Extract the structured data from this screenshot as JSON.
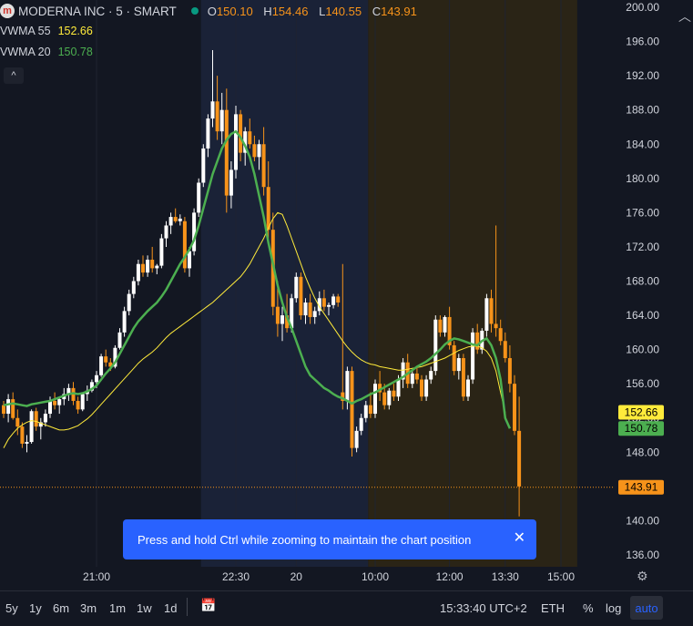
{
  "header": {
    "logo_letter": "m",
    "symbol": "MODERNA INC · 5 · SMART",
    "ohlc": [
      {
        "k": "O",
        "v": "150.10"
      },
      {
        "k": "H",
        "v": "154.46"
      },
      {
        "k": "L",
        "v": "140.55"
      },
      {
        "k": "C",
        "v": "143.91"
      }
    ],
    "vwma55_label": "VWMA 55",
    "vwma55_value": "152.66",
    "vwma20_label": "VWMA 20",
    "vwma20_value": "150.78",
    "collapse_icon": "^"
  },
  "toast": {
    "message": "Press and hold Ctrl while zooming to maintain the chart position",
    "close": "✕"
  },
  "bottom": {
    "ranges": [
      "5y",
      "1y",
      "6m",
      "3m",
      "1m",
      "1w",
      "1d"
    ],
    "time": "15:33:40 UTC+2",
    "session": "ETH",
    "percent": "%",
    "log": "log",
    "auto": "auto"
  },
  "colors": {
    "up": "#ffffff",
    "down": "#f7931a",
    "vwma20": "#4caf50",
    "vwma55": "#ffeb3b",
    "premarket_bg": "#1a2237",
    "postmarket_bg": "#2a2416",
    "price_badge": "#f7931a"
  },
  "chart_data": {
    "type": "candlestick",
    "yaxis": {
      "min": 136,
      "max": 200,
      "step": 4,
      "ticks": [
        "200.00",
        "196.00",
        "192.00",
        "188.00",
        "184.00",
        "180.00",
        "176.00",
        "172.00",
        "168.00",
        "164.00",
        "160.00",
        "156.00",
        "152.00",
        "148.00",
        "144.00",
        "140.00",
        "136.00"
      ]
    },
    "xaxis": {
      "ticks": [
        {
          "label": "21:00",
          "bar": 20
        },
        {
          "label": "22:30",
          "bar": 50
        },
        {
          "label": "20",
          "bar": 63
        },
        {
          "label": "10:00",
          "bar": 80
        },
        {
          "label": "12:00",
          "bar": 96
        },
        {
          "label": "13:30",
          "bar": 108
        },
        {
          "label": "15:00",
          "bar": 120
        }
      ]
    },
    "sessions": [
      {
        "kind": "premarket",
        "from": 43,
        "to": 79
      },
      {
        "kind": "postmarket",
        "from": 79,
        "to": 124
      }
    ],
    "last_price": 143.91,
    "price_labels": [
      {
        "text": "152.66",
        "value": 152.66,
        "color": "#ffeb3b",
        "text_color": "#000000"
      },
      {
        "text": "150.78",
        "value": 150.78,
        "color": "#4caf50",
        "text_color": "#000000"
      },
      {
        "text": "143.91",
        "value": 143.91,
        "color": "#f7931a",
        "text_color": "#000000"
      }
    ],
    "candles": [
      [
        153.5,
        154.0,
        152.0,
        152.5
      ],
      [
        152.5,
        154.8,
        151.5,
        154.2
      ],
      [
        154.2,
        155.0,
        151.8,
        152.0
      ],
      [
        152.0,
        153.0,
        150.0,
        151.0
      ],
      [
        151.0,
        151.5,
        148.5,
        149.0
      ],
      [
        149.0,
        150.0,
        148.0,
        149.2
      ],
      [
        149.2,
        153.0,
        149.0,
        152.8
      ],
      [
        152.8,
        153.2,
        150.5,
        151.0
      ],
      [
        151.0,
        152.0,
        149.5,
        151.5
      ],
      [
        151.5,
        153.0,
        151.0,
        152.5
      ],
      [
        152.5,
        154.5,
        152.0,
        154.0
      ],
      [
        154.0,
        155.0,
        153.0,
        153.5
      ],
      [
        153.5,
        154.5,
        152.5,
        154.2
      ],
      [
        154.2,
        155.5,
        153.5,
        154.8
      ],
      [
        154.8,
        156.0,
        154.0,
        155.5
      ],
      [
        155.5,
        156.2,
        153.5,
        154.0
      ],
      [
        154.0,
        154.5,
        152.5,
        153.0
      ],
      [
        153.0,
        155.0,
        152.8,
        154.8
      ],
      [
        154.8,
        155.8,
        154.0,
        155.2
      ],
      [
        155.2,
        156.5,
        155.0,
        156.2
      ],
      [
        156.2,
        157.5,
        155.5,
        157.0
      ],
      [
        157.0,
        159.5,
        156.8,
        159.2
      ],
      [
        159.2,
        160.0,
        158.0,
        158.5
      ],
      [
        158.5,
        159.0,
        157.5,
        158.0
      ],
      [
        158.0,
        160.5,
        157.8,
        160.2
      ],
      [
        160.2,
        162.5,
        160.0,
        162.0
      ],
      [
        162.0,
        165.0,
        161.5,
        164.5
      ],
      [
        164.5,
        167.0,
        164.0,
        166.5
      ],
      [
        166.5,
        168.5,
        166.0,
        168.0
      ],
      [
        168.0,
        170.5,
        167.5,
        170.0
      ],
      [
        170.0,
        171.0,
        168.5,
        169.0
      ],
      [
        169.0,
        171.0,
        168.5,
        170.5
      ],
      [
        170.5,
        172.0,
        169.0,
        169.5
      ],
      [
        169.5,
        170.0,
        168.8,
        169.8
      ],
      [
        169.8,
        173.5,
        169.5,
        173.0
      ],
      [
        173.0,
        175.0,
        172.0,
        174.5
      ],
      [
        174.5,
        176.0,
        173.5,
        175.5
      ],
      [
        175.5,
        176.5,
        174.8,
        175.0
      ],
      [
        175.0,
        175.8,
        174.5,
        175.3
      ],
      [
        175.0,
        175.5,
        169.0,
        169.5
      ],
      [
        169.5,
        172.0,
        168.5,
        171.5
      ],
      [
        171.5,
        176.5,
        171.0,
        176.0
      ],
      [
        176.0,
        180.0,
        175.5,
        179.5
      ],
      [
        179.5,
        184.0,
        179.0,
        183.5
      ],
      [
        183.5,
        187.5,
        182.5,
        187.0
      ],
      [
        187.0,
        195.0,
        186.0,
        189.0
      ],
      [
        189.0,
        192.0,
        184.5,
        185.5
      ],
      [
        185.5,
        190.0,
        184.0,
        188.0
      ],
      [
        188.0,
        190.5,
        176.0,
        178.0
      ],
      [
        178.0,
        182.0,
        176.5,
        181.0
      ],
      [
        181.0,
        188.5,
        180.0,
        187.5
      ],
      [
        187.5,
        188.0,
        182.0,
        183.0
      ],
      [
        183.0,
        186.0,
        181.5,
        185.5
      ],
      [
        185.5,
        187.0,
        183.5,
        184.0
      ],
      [
        184.0,
        185.0,
        182.0,
        182.5
      ],
      [
        182.5,
        184.5,
        181.0,
        184.0
      ],
      [
        184.0,
        186.0,
        178.0,
        179.0
      ],
      [
        179.0,
        182.0,
        173.0,
        174.0
      ],
      [
        174.0,
        176.0,
        164.0,
        165.0
      ],
      [
        165.0,
        168.0,
        161.5,
        163.0
      ],
      [
        163.0,
        165.0,
        161.0,
        164.0
      ],
      [
        164.0,
        166.5,
        162.0,
        162.5
      ],
      [
        162.5,
        166.5,
        162.0,
        166.0
      ],
      [
        166.0,
        169.0,
        165.5,
        168.5
      ],
      [
        168.5,
        169.0,
        163.5,
        164.0
      ],
      [
        164.0,
        166.0,
        163.0,
        165.5
      ],
      [
        165.5,
        166.5,
        163.0,
        163.8
      ],
      [
        163.8,
        165.0,
        163.0,
        164.5
      ],
      [
        164.5,
        166.8,
        164.0,
        166.0
      ],
      [
        166.0,
        167.0,
        164.5,
        165.0
      ],
      [
        165.0,
        165.5,
        164.0,
        165.2
      ],
      [
        165.2,
        166.5,
        164.8,
        166.2
      ],
      [
        166.2,
        166.5,
        165.0,
        165.5
      ],
      [
        155.0,
        170.0,
        153.0,
        154.0
      ],
      [
        154.0,
        158.0,
        153.0,
        157.5
      ],
      [
        157.5,
        158.0,
        147.5,
        148.5
      ],
      [
        148.5,
        151.0,
        148.0,
        150.5
      ],
      [
        150.5,
        152.5,
        150.0,
        152.0
      ],
      [
        152.0,
        154.0,
        151.5,
        153.5
      ],
      [
        153.5,
        155.0,
        152.0,
        152.5
      ],
      [
        152.5,
        156.5,
        152.0,
        156.0
      ],
      [
        156.0,
        157.5,
        154.0,
        155.0
      ],
      [
        155.0,
        156.0,
        153.0,
        153.5
      ],
      [
        153.5,
        155.5,
        153.0,
        155.2
      ],
      [
        155.2,
        156.0,
        154.0,
        154.5
      ],
      [
        154.5,
        157.0,
        154.0,
        156.5
      ],
      [
        156.5,
        159.0,
        155.5,
        158.5
      ],
      [
        158.5,
        159.5,
        155.5,
        156.0
      ],
      [
        156.0,
        157.5,
        155.5,
        157.2
      ],
      [
        157.2,
        158.0,
        156.0,
        156.5
      ],
      [
        156.5,
        157.0,
        154.0,
        154.5
      ],
      [
        154.5,
        157.0,
        154.0,
        156.5
      ],
      [
        156.5,
        158.0,
        156.0,
        157.5
      ],
      [
        157.5,
        164.0,
        157.0,
        163.5
      ],
      [
        163.5,
        164.0,
        161.5,
        162.0
      ],
      [
        162.0,
        164.0,
        161.5,
        163.8
      ],
      [
        163.8,
        165.0,
        160.0,
        160.5
      ],
      [
        160.5,
        161.0,
        157.0,
        157.5
      ],
      [
        157.5,
        159.5,
        156.5,
        159.0
      ],
      [
        159.0,
        159.5,
        154.0,
        154.5
      ],
      [
        154.5,
        157.0,
        154.0,
        156.5
      ],
      [
        156.5,
        162.5,
        156.0,
        162.0
      ],
      [
        162.0,
        163.0,
        159.5,
        160.0
      ],
      [
        160.0,
        162.5,
        159.5,
        162.2
      ],
      [
        162.2,
        166.5,
        161.5,
        166.0
      ],
      [
        166.0,
        167.0,
        162.0,
        163.0
      ],
      [
        163.0,
        174.5,
        161.5,
        162.5
      ],
      [
        162.5,
        163.5,
        160.5,
        161.0
      ],
      [
        161.0,
        162.0,
        158.5,
        159.0
      ],
      [
        159.0,
        160.5,
        155.0,
        156.0
      ],
      [
        156.0,
        157.0,
        150.0,
        150.5
      ],
      [
        150.5,
        154.5,
        140.5,
        144.0
      ]
    ],
    "vwma20": [
      153.5,
      153.6,
      153.7,
      153.6,
      153.5,
      153.4,
      153.6,
      153.7,
      153.8,
      153.9,
      154.0,
      154.2,
      154.4,
      154.6,
      154.8,
      154.9,
      154.8,
      154.9,
      155.1,
      155.4,
      155.8,
      156.5,
      157.2,
      157.8,
      158.5,
      159.5,
      160.5,
      161.5,
      162.5,
      163.3,
      163.9,
      164.5,
      165.0,
      165.5,
      166.2,
      167.0,
      168.0,
      169.0,
      170.0,
      170.8,
      171.7,
      172.8,
      174.5,
      176.5,
      178.5,
      180.5,
      182.0,
      183.5,
      184.5,
      185.2,
      185.5,
      184.8,
      183.8,
      182.5,
      180.5,
      178.0,
      175.5,
      172.5,
      170.0,
      167.5,
      165.5,
      163.8,
      162.5,
      161.0,
      159.5,
      158.0,
      157.0,
      156.5,
      156.0,
      155.5,
      155.2,
      154.8,
      154.5,
      154.3,
      154.0,
      153.7,
      154.0,
      154.2,
      154.5,
      154.8,
      155.0,
      155.3,
      155.6,
      155.9,
      156.2,
      156.5,
      156.8,
      157.2,
      157.6,
      158.0,
      158.3,
      158.6,
      159.0,
      159.5,
      160.0,
      160.6,
      161.0,
      161.3,
      161.2,
      161.0,
      160.8,
      160.6,
      160.5,
      161.0,
      161.3,
      160.5,
      159.0,
      156.5,
      152.0,
      150.78
    ],
    "vwma55": [
      148.5,
      149.5,
      150.2,
      150.8,
      151.2,
      151.5,
      151.7,
      151.6,
      151.4,
      151.2,
      151.0,
      150.8,
      150.6,
      150.6,
      150.7,
      150.9,
      151.1,
      151.5,
      151.9,
      152.4,
      153.0,
      153.6,
      154.2,
      154.8,
      155.4,
      156.0,
      156.6,
      157.2,
      157.8,
      158.4,
      158.9,
      159.3,
      159.7,
      160.2,
      160.8,
      161.4,
      161.9,
      162.3,
      162.7,
      163.1,
      163.5,
      163.9,
      164.3,
      164.7,
      165.1,
      165.5,
      166.0,
      166.5,
      167.0,
      167.5,
      168.0,
      168.5,
      169.2,
      170.0,
      171.0,
      172.0,
      173.0,
      174.2,
      175.3,
      176.0,
      175.8,
      174.5,
      173.0,
      171.5,
      170.0,
      168.5,
      167.2,
      166.0,
      165.0,
      164.2,
      163.4,
      162.6,
      161.8,
      161.0,
      160.3,
      159.7,
      159.2,
      158.8,
      158.5,
      158.3,
      158.2,
      158.0,
      157.9,
      157.8,
      157.7,
      157.6,
      157.6,
      157.7,
      157.8,
      157.9,
      158.0,
      158.2,
      158.4,
      158.6,
      158.8,
      159.0,
      159.3,
      159.6,
      159.9,
      160.1,
      160.3,
      160.4,
      160.4,
      160.2,
      159.8,
      159.0,
      157.5,
      155.0,
      152.66
    ]
  }
}
